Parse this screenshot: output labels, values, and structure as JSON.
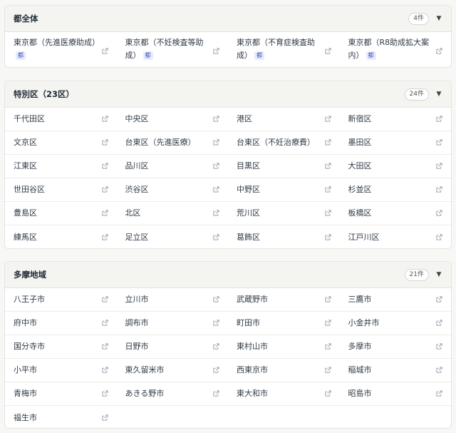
{
  "sections": [
    {
      "title": "都全体",
      "count": "4件",
      "items": [
        {
          "label": "東京都（先進医療助成）",
          "tag": "都"
        },
        {
          "label": "東京都（不妊検査等助成）",
          "tag": "都"
        },
        {
          "label": "東京都（不育症検査助成）",
          "tag": "都"
        },
        {
          "label": "東京都（R8助成拡大案内）",
          "tag": "都"
        }
      ]
    },
    {
      "title": "特別区（23区）",
      "count": "24件",
      "items": [
        {
          "label": "千代田区"
        },
        {
          "label": "中央区"
        },
        {
          "label": "港区"
        },
        {
          "label": "新宿区"
        },
        {
          "label": "文京区"
        },
        {
          "label": "台東区（先進医療）"
        },
        {
          "label": "台東区（不妊治療費）"
        },
        {
          "label": "墨田区"
        },
        {
          "label": "江東区"
        },
        {
          "label": "品川区"
        },
        {
          "label": "目黒区"
        },
        {
          "label": "大田区"
        },
        {
          "label": "世田谷区"
        },
        {
          "label": "渋谷区"
        },
        {
          "label": "中野区"
        },
        {
          "label": "杉並区"
        },
        {
          "label": "豊島区"
        },
        {
          "label": "北区"
        },
        {
          "label": "荒川区"
        },
        {
          "label": "板橋区"
        },
        {
          "label": "練馬区"
        },
        {
          "label": "足立区"
        },
        {
          "label": "葛飾区"
        },
        {
          "label": "江戸川区"
        }
      ]
    },
    {
      "title": "多摩地域",
      "count": "21件",
      "items": [
        {
          "label": "八王子市"
        },
        {
          "label": "立川市"
        },
        {
          "label": "武蔵野市"
        },
        {
          "label": "三鷹市"
        },
        {
          "label": "府中市"
        },
        {
          "label": "調布市"
        },
        {
          "label": "町田市"
        },
        {
          "label": "小金井市"
        },
        {
          "label": "国分寺市"
        },
        {
          "label": "日野市"
        },
        {
          "label": "東村山市"
        },
        {
          "label": "多摩市"
        },
        {
          "label": "小平市"
        },
        {
          "label": "東久留米市"
        },
        {
          "label": "西東京市"
        },
        {
          "label": "稲城市"
        },
        {
          "label": "青梅市"
        },
        {
          "label": "あきる野市"
        },
        {
          "label": "東大和市"
        },
        {
          "label": "昭島市"
        },
        {
          "label": "福生市"
        }
      ]
    }
  ],
  "icons": {
    "toggle": "chevron-down-icon",
    "link": "external-link-icon"
  },
  "colors": {
    "tag_bg": "#e6eaff",
    "tag_text": "#3b4fb8",
    "header_bg": "#f4f4f1"
  }
}
